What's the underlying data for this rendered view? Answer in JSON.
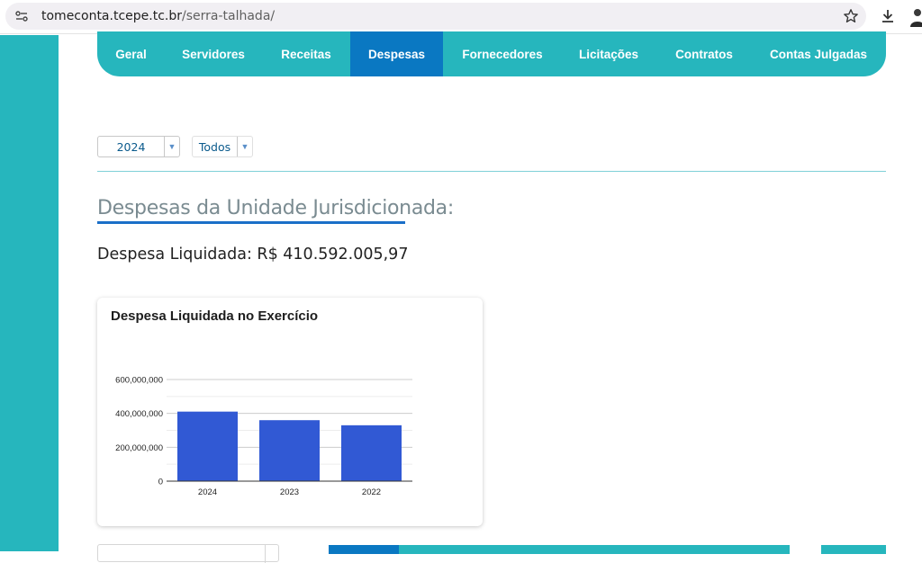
{
  "browser": {
    "url_host": "tomeconta.tcepe.tc.br",
    "url_path": "/serra-talhada/"
  },
  "nav": {
    "items": [
      {
        "label": "Geral",
        "active": false
      },
      {
        "label": "Servidores",
        "active": false
      },
      {
        "label": "Receitas",
        "active": false
      },
      {
        "label": "Despesas",
        "active": true
      },
      {
        "label": "Fornecedores",
        "active": false
      },
      {
        "label": "Licitações",
        "active": false
      },
      {
        "label": "Contratos",
        "active": false
      },
      {
        "label": "Contas Julgadas",
        "active": false
      }
    ]
  },
  "filters": {
    "year": "2024",
    "type": "Todos"
  },
  "section": {
    "title": "Despesas da Unidade Jurisdicionada:",
    "despesa_liquidada": "Despesa Liquidada: R$ 410.592.005,97"
  },
  "chart_card": {
    "title": "Despesa Liquidada no Exercício"
  },
  "chart_data": {
    "type": "bar",
    "title": "Despesa Liquidada no Exercício",
    "categories": [
      "2024",
      "2023",
      "2022"
    ],
    "values": [
      410592005.97,
      360000000,
      330000000
    ],
    "ylim": [
      0,
      600000000
    ],
    "yticks": [
      "0",
      "200,000,000",
      "400,000,000",
      "600,000,000"
    ],
    "color": "#3159d4",
    "grid": true
  },
  "colors": {
    "accent": "#26b6bd",
    "active_tab": "#0a78c2",
    "bar": "#3159d4"
  }
}
